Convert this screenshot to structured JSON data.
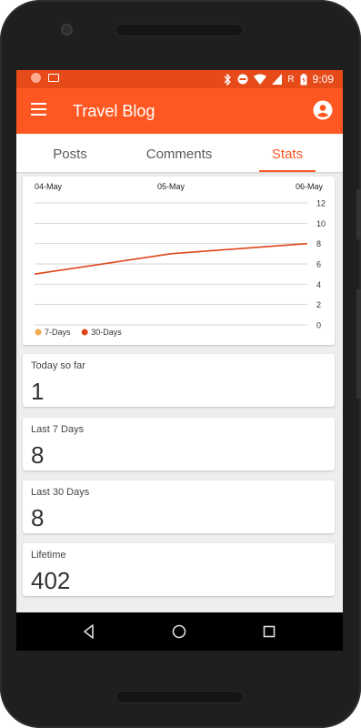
{
  "status_bar": {
    "time": "9:09",
    "network_letter": "R"
  },
  "app_bar": {
    "title": "Travel Blog",
    "menu_icon": "hamburger-menu-icon",
    "account_icon": "account-circle-icon"
  },
  "tabs": [
    {
      "label": "Posts",
      "selected": false
    },
    {
      "label": "Comments",
      "selected": false
    },
    {
      "label": "Stats",
      "selected": true
    }
  ],
  "colors": {
    "accent": "#ff5722",
    "status_bar": "#e64a19",
    "series_7d": "#f0a955",
    "series_30d": "#e0461b"
  },
  "chart_data": {
    "type": "line",
    "x_tick_labels": [
      "04-May",
      "05-May",
      "06-May"
    ],
    "x": [
      0,
      1,
      2
    ],
    "ylim": [
      0,
      12
    ],
    "y_ticks": [
      0,
      2,
      4,
      6,
      8,
      10,
      12
    ],
    "grid": true,
    "legend_position": "bottom-left",
    "series": [
      {
        "name": "7-Days",
        "color": "#f0a955",
        "values": []
      },
      {
        "name": "30-Days",
        "color": "#e0461b",
        "values": [
          5,
          7,
          8
        ]
      }
    ]
  },
  "stats": [
    {
      "label": "Today so far",
      "value": "1"
    },
    {
      "label": "Last 7 Days",
      "value": "8"
    },
    {
      "label": "Last 30 Days",
      "value": "8"
    },
    {
      "label": "Lifetime",
      "value": "402"
    }
  ]
}
